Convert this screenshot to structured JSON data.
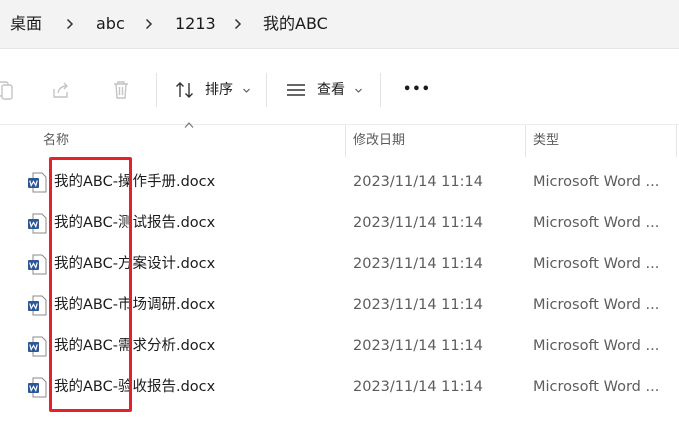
{
  "breadcrumb": {
    "items": [
      "桌面",
      "abc",
      "1213",
      "我的ABC"
    ]
  },
  "toolbar": {
    "sort_label": "排序",
    "view_label": "查看",
    "more_label": "•••"
  },
  "columns": {
    "name": "名称",
    "modified": "修改日期",
    "type": "类型"
  },
  "files": [
    {
      "name": "我的ABC-操作手册.docx",
      "modified": "2023/11/14 11:14",
      "type": "Microsoft Word ..."
    },
    {
      "name": "我的ABC-测试报告.docx",
      "modified": "2023/11/14 11:14",
      "type": "Microsoft Word ..."
    },
    {
      "name": "我的ABC-方案设计.docx",
      "modified": "2023/11/14 11:14",
      "type": "Microsoft Word ..."
    },
    {
      "name": "我的ABC-市场调研.docx",
      "modified": "2023/11/14 11:14",
      "type": "Microsoft Word ..."
    },
    {
      "name": "我的ABC-需求分析.docx",
      "modified": "2023/11/14 11:14",
      "type": "Microsoft Word ..."
    },
    {
      "name": "我的ABC-验收报告.docx",
      "modified": "2023/11/14 11:14",
      "type": "Microsoft Word ..."
    }
  ],
  "colors": {
    "word_blue": "#2b5797",
    "highlight_red": "#e8202a"
  }
}
